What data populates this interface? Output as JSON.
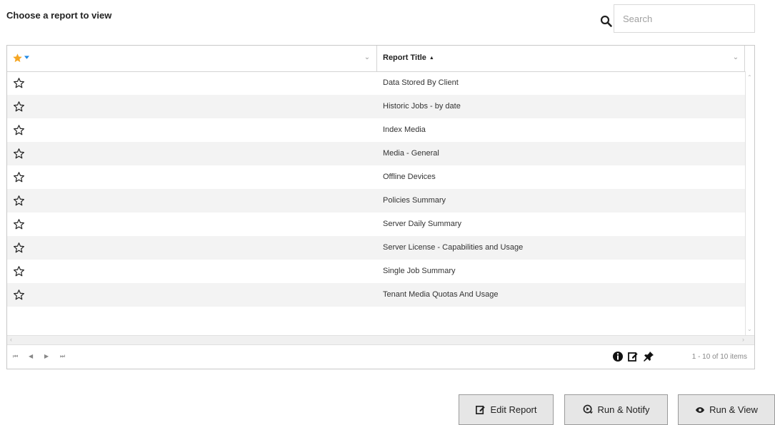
{
  "page": {
    "title": "Choose a report to view"
  },
  "search": {
    "placeholder": "Search",
    "value": ""
  },
  "grid": {
    "columns": [
      {
        "key": "favorite",
        "label": "",
        "sort": "desc",
        "icon": "star-filled-icon"
      },
      {
        "key": "report_title",
        "label": "Report Title",
        "sort": "asc",
        "sort_glyph": "▲"
      }
    ],
    "column_menu_glyph": "⌄",
    "rows": [
      {
        "favorite": false,
        "title": "Data Stored By Client"
      },
      {
        "favorite": false,
        "title": "Historic Jobs - by date"
      },
      {
        "favorite": false,
        "title": "Index Media"
      },
      {
        "favorite": false,
        "title": "Media - General"
      },
      {
        "favorite": false,
        "title": "Offline Devices"
      },
      {
        "favorite": false,
        "title": "Policies Summary"
      },
      {
        "favorite": false,
        "title": "Server Daily Summary"
      },
      {
        "favorite": false,
        "title": "Server License - Capabilities and Usage"
      },
      {
        "favorite": false,
        "title": "Single Job Summary"
      },
      {
        "favorite": false,
        "title": "Tenant Media Quotas And Usage"
      }
    ],
    "pager": {
      "first": "⏮",
      "prev": "◀",
      "next": "▶",
      "last": "⏭",
      "info": "1 - 10 of 10 items",
      "icons": [
        "info-icon",
        "edit-icon",
        "pin-icon"
      ]
    }
  },
  "actions": {
    "edit_report": "Edit Report",
    "run_notify": "Run & Notify",
    "run_view": "Run & View"
  },
  "colors": {
    "star_gold": "#f5a623",
    "sort_blue": "#1e88e5",
    "button_bg": "#e6e6e6",
    "alt_row": "#f3f3f3"
  }
}
